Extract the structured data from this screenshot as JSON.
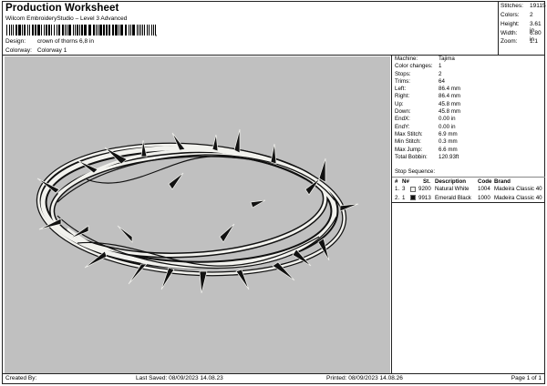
{
  "header": {
    "title": "Production Worksheet",
    "subtitle": "Wilcom EmbroideryStudio – Level 3 Advanced",
    "barcode_mark": ","
  },
  "design": {
    "label": "Design:",
    "value": "crown of thorns 6,8 in"
  },
  "colorway": {
    "label": "Colorway:",
    "value": "Colorway 1"
  },
  "stats": [
    {
      "label": "Stitches:",
      "value": "19115"
    },
    {
      "label": "Colors:",
      "value": "2"
    },
    {
      "label": "Height:",
      "value": "3.61 in"
    },
    {
      "label": "Width:",
      "value": "6.80 in"
    },
    {
      "label": "Zoom:",
      "value": "1:1"
    }
  ],
  "info": [
    {
      "label": "Machine:",
      "value": "Tajima"
    },
    {
      "label": "Color changes:",
      "value": "1"
    },
    {
      "label": "Stops:",
      "value": "2"
    },
    {
      "label": "Trims:",
      "value": "64"
    },
    {
      "label": "Left:",
      "value": "86.4 mm"
    },
    {
      "label": "Right:",
      "value": "86.4 mm"
    },
    {
      "label": "Up:",
      "value": "45.8 mm"
    },
    {
      "label": "Down:",
      "value": "45.8 mm"
    },
    {
      "label": "EndX:",
      "value": "0.00 in"
    },
    {
      "label": "EndY:",
      "value": "0.00 in"
    },
    {
      "label": "Max Stitch:",
      "value": "6.9 mm"
    },
    {
      "label": "Min Stitch:",
      "value": "0.3 mm"
    },
    {
      "label": "Max Jump:",
      "value": "6.6 mm"
    },
    {
      "label": "Total Bobbin:",
      "value": "120.93ft"
    }
  ],
  "stop_sequence": {
    "title": "Stop Sequence:",
    "columns": {
      "num": "#",
      "n": "N#",
      "st": "St.",
      "description": "Description",
      "code": "Code",
      "brand": "Brand"
    },
    "rows": [
      {
        "num": "1.",
        "n": "3",
        "swatch": "#f2f2ee",
        "st": "9200",
        "description": "Natural White",
        "code": "1004",
        "brand": "Madeira Classic 40"
      },
      {
        "num": "2.",
        "n": "1",
        "swatch": "#111111",
        "st": "9913",
        "description": "Emerald Black",
        "code": "1000",
        "brand": "Madeira Classic 40"
      }
    ]
  },
  "footer": {
    "created": "Created By:",
    "saved": "Last Saved: 08/09/2023 14.08.23",
    "printed": "Printed: 08/09/2023 14.08.26",
    "page": "Page 1 of 1"
  },
  "colors": {
    "preview_bg": "#c0c0c0",
    "thread_white": "#f2f2ee",
    "thread_black": "#111111",
    "border": "#222222"
  }
}
